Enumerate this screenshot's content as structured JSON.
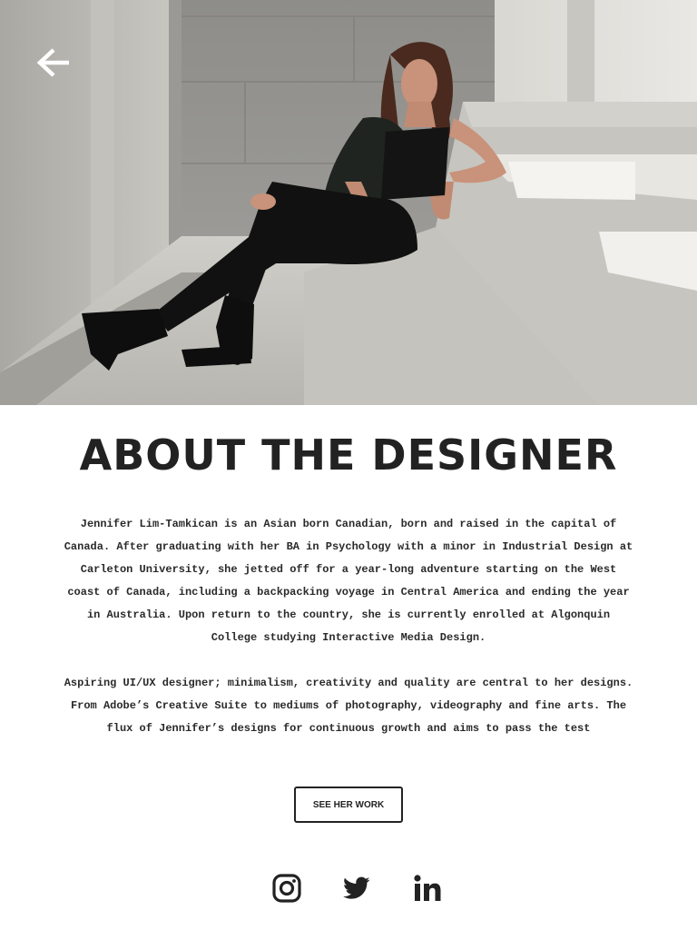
{
  "header": {
    "hero_photo": "photo of the designer seated on concrete steps",
    "back_icon": "arrow-left-icon"
  },
  "main": {
    "title": "ABOUT THE DESIGNER",
    "bio_paragraphs": [
      "Jennifer Lim-Tamkican is an Asian born Canadian, born and raised in the capital of Canada. After graduating with her BA in Psychology with a minor in Industrial Design at Carleton University, she jetted off for a year-long adventure starting on the West coast of Canada, including a backpacking voyage in Central America and ending the year in Australia. Upon return to the country, she is currently enrolled at Algonquin College studying Interactive Media Design.",
      "Aspiring UI/UX designer; minimalism, creativity and quality are central to her designs. From Adobe’s Creative Suite to mediums of photography, videography and fine arts. The flux of Jennifer’s designs for continuous growth and aims to pass the test"
    ],
    "cta_label": "SEE HER WORK"
  },
  "social": {
    "icons": [
      "instagram-icon",
      "twitter-icon",
      "linkedin-icon"
    ]
  },
  "colors": {
    "text": "#222222",
    "background": "#ffffff"
  }
}
